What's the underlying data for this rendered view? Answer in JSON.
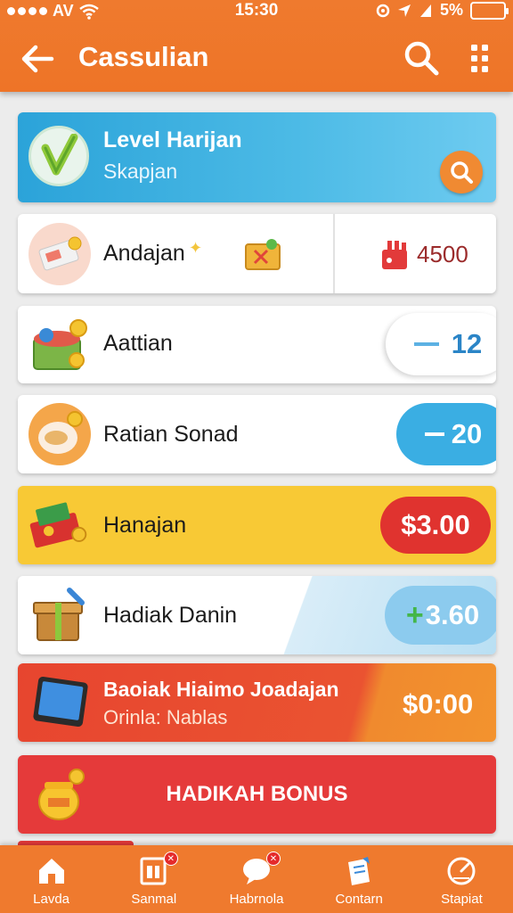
{
  "status_bar": {
    "carrier": "AV",
    "time": "15:30",
    "battery": "5%"
  },
  "header": {
    "title": "Cassulian"
  },
  "level_card": {
    "title": "Level Harijan",
    "subtitle": "Skapjan"
  },
  "rows": [
    {
      "label": "Andajan",
      "value": "4500"
    },
    {
      "label": "Aattian",
      "value": "12"
    },
    {
      "label": "Ratian Sonad",
      "value": "20"
    },
    {
      "label": "Hanajan",
      "value": "$3.00"
    },
    {
      "label": "Hadiak Danin",
      "value": "3.60"
    }
  ],
  "promo": {
    "title": "Baoiak Hiaimo Joadajan",
    "subtitle": "Orinla: Nablas",
    "price": "$0:00"
  },
  "bonus": {
    "label": "HADIKAH BONUS"
  },
  "nav": [
    {
      "label": "Lavda"
    },
    {
      "label": "Sanmal"
    },
    {
      "label": "Habrnola"
    },
    {
      "label": "Contarn"
    },
    {
      "label": "Stapiat"
    }
  ],
  "colors": {
    "brand": "#ee7427",
    "blue": "#27a8dc",
    "yellow": "#f7c62f",
    "red": "#e53a3a"
  }
}
